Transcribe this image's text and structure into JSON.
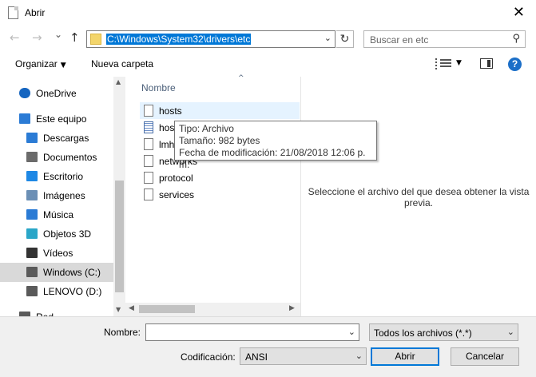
{
  "window": {
    "title": "Abrir",
    "close_glyph": "✕"
  },
  "nav": {
    "back_glyph": "←",
    "forward_glyph": "→",
    "recent_glyph": "⌄",
    "up_glyph": "↑",
    "address": "C:\\Windows\\System32\\drivers\\etc",
    "address_dropdown": "⌄",
    "refresh_glyph": "↻",
    "search_placeholder": "Buscar en etc",
    "search_glyph": "⚲"
  },
  "toolbar": {
    "organize": "Organizar",
    "new_folder": "Nueva carpeta",
    "help": "?"
  },
  "sidebar": {
    "items": [
      {
        "label": "OneDrive",
        "icon": "cloud-icon",
        "color": "#1565c0"
      },
      {
        "label": "Este equipo",
        "icon": "computer-icon",
        "color": "#2b7bd5"
      },
      {
        "label": "Descargas",
        "icon": "download-icon",
        "color": "#2b7bd5"
      },
      {
        "label": "Documentos",
        "icon": "document-icon",
        "color": "#6b6b6b"
      },
      {
        "label": "Escritorio",
        "icon": "desktop-icon",
        "color": "#1e88e5"
      },
      {
        "label": "Imágenes",
        "icon": "pictures-icon",
        "color": "#6b8fb5"
      },
      {
        "label": "Música",
        "icon": "music-icon",
        "color": "#2b7bd5"
      },
      {
        "label": "Objetos 3D",
        "icon": "cube-icon",
        "color": "#2aa6c8"
      },
      {
        "label": "Vídeos",
        "icon": "video-icon",
        "color": "#333333"
      },
      {
        "label": "Windows (C:)",
        "icon": "drive-icon",
        "color": "#5a5a5a"
      },
      {
        "label": "LENOVO (D:)",
        "icon": "drive-icon",
        "color": "#5a5a5a"
      },
      {
        "label": "Red",
        "icon": "network-icon",
        "color": "#5a5a5a"
      }
    ],
    "selected_index": 9
  },
  "files": {
    "column_header": "Nombre",
    "sort_glyph": "^",
    "items": [
      {
        "name": "hosts",
        "icon": "file-icon",
        "hover": true
      },
      {
        "name": "hosts.ics",
        "icon": "calendar-file-icon",
        "hover": false
      },
      {
        "name": "lmhosts.sam",
        "icon": "file-icon",
        "hover": false
      },
      {
        "name": "networks",
        "icon": "file-icon",
        "hover": false
      },
      {
        "name": "protocol",
        "icon": "file-icon",
        "hover": false
      },
      {
        "name": "services",
        "icon": "file-icon",
        "hover": false
      }
    ]
  },
  "tooltip": {
    "line1": "Tipo: Archivo",
    "line2": "Tamaño: 982 bytes",
    "line3": "Fecha de modificación: 21/08/2018 12:06 p. m."
  },
  "preview": {
    "message": "Seleccione el archivo del que desea obtener la vista previa."
  },
  "footer": {
    "name_label": "Nombre:",
    "name_value": "",
    "filter_value": "Todos los archivos  (*.*)",
    "encoding_label": "Codificación:",
    "encoding_value": "ANSI",
    "open_label": "Abrir",
    "cancel_label": "Cancelar"
  },
  "colors": {
    "accent": "#0078d7",
    "selection": "#cce8ff",
    "hover": "#e5f3ff"
  }
}
